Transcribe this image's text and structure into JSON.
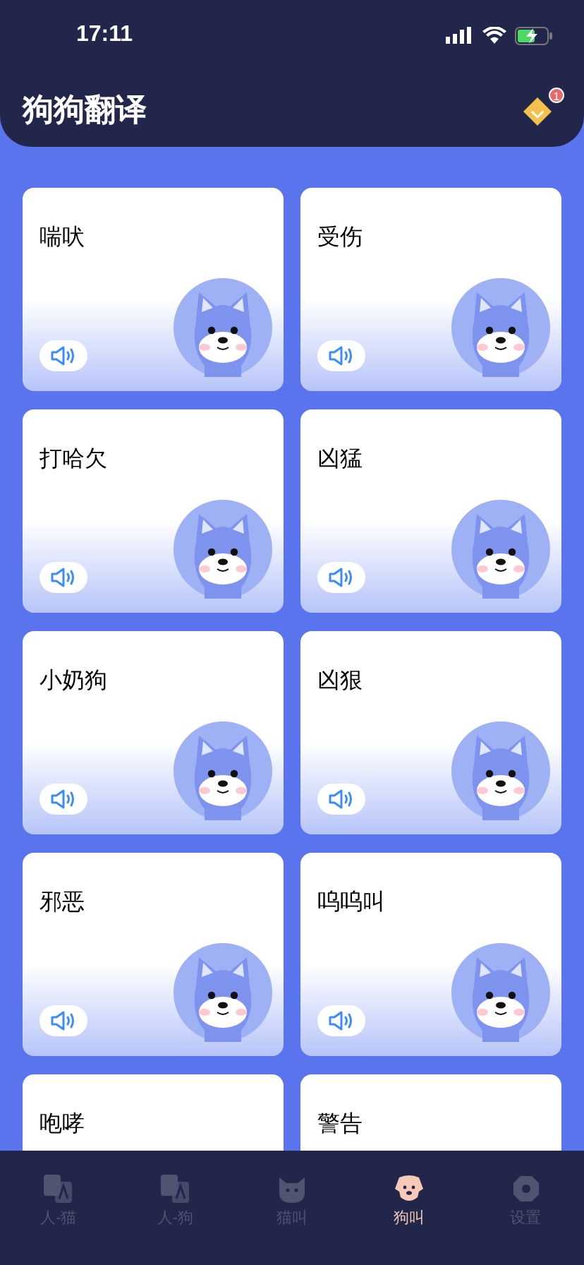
{
  "status_bar": {
    "time": "17:11"
  },
  "header": {
    "title": "狗狗翻译",
    "badge": "1"
  },
  "cards": [
    {
      "label": "喘吠",
      "kind": "full"
    },
    {
      "label": "受伤",
      "kind": "full"
    },
    {
      "label": "打哈欠",
      "kind": "full"
    },
    {
      "label": "凶猛",
      "kind": "full"
    },
    {
      "label": "小奶狗",
      "kind": "full"
    },
    {
      "label": "凶狠",
      "kind": "full"
    },
    {
      "label": "邪恶",
      "kind": "full"
    },
    {
      "label": "呜呜叫",
      "kind": "full"
    },
    {
      "label": "咆哮",
      "kind": "cut"
    },
    {
      "label": "警告",
      "kind": "cut"
    }
  ],
  "tab_bar": [
    {
      "label": "人-猫",
      "kind": "translate",
      "selected": false
    },
    {
      "label": "人-狗",
      "kind": "translate",
      "selected": false
    },
    {
      "label": "猫叫",
      "kind": "cat",
      "selected": false
    },
    {
      "label": "狗叫",
      "kind": "dog",
      "selected": true
    },
    {
      "label": "设置",
      "kind": "settings",
      "selected": false
    }
  ]
}
